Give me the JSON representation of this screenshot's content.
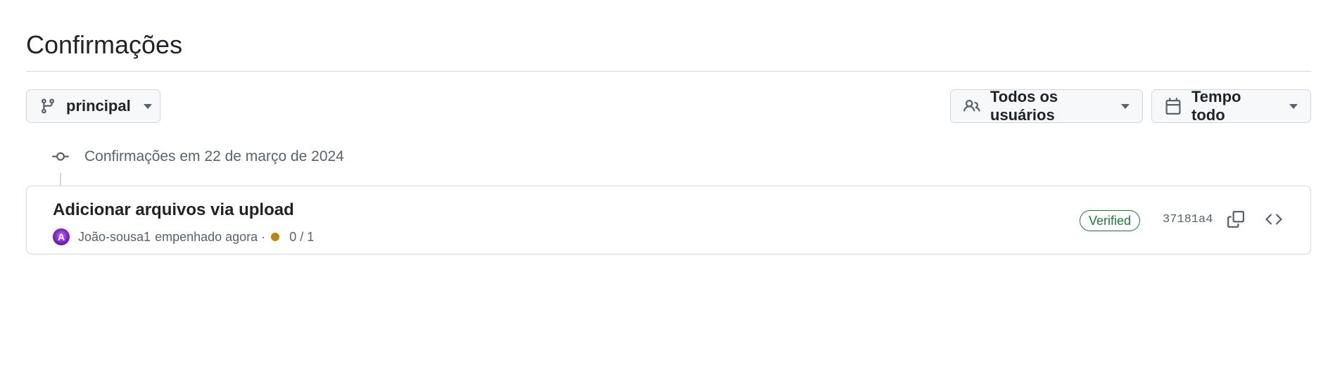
{
  "page": {
    "title": "Confirmações"
  },
  "filters": {
    "branch": {
      "label": "principal",
      "icon": "git-branch-icon"
    },
    "users": {
      "label": "Todos os usuários",
      "icon": "people-icon"
    },
    "time": {
      "label": "Tempo todo",
      "icon": "calendar-icon"
    }
  },
  "commit_groups": [
    {
      "label": "Confirmações em 22 de março de 2024",
      "icon": "git-commit-icon",
      "commits": [
        {
          "title": "Adicionar arquivos via upload",
          "author": "João-sousa1",
          "action": "empenhado agora ·",
          "status_color": "#bf8700",
          "checks": "0 / 1",
          "verified": "Verified",
          "sha": "37181a4"
        }
      ]
    }
  ],
  "colors": {
    "verified": "#1a7f37",
    "pending": "#bf8700",
    "border": "#d0d7de",
    "muted": "#59636e"
  }
}
